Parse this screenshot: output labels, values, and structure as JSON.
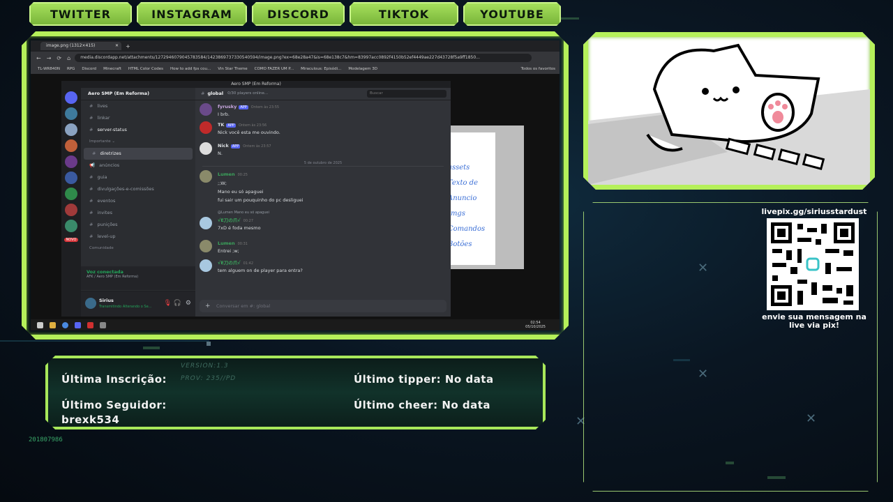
{
  "social_links": [
    "TWITTER",
    "INSTAGRAM",
    "DISCORD",
    "TIKTOK",
    "YOUTUBE"
  ],
  "browser": {
    "tab_title": "image.png (1312×415)",
    "url": "media.discordapp.net/attachments/1272946079045783584/1423869737330540594/image.png?ex=68e28a47&is=68e138c7&hm=83997acc0892f4150b52ef4449ae227d43728f5a9ff1850...",
    "bookmarks": [
      "TL-WR840N",
      "RPG",
      "Discord",
      "Minecraft",
      "HTML Color Codes",
      "How to add fps cou...",
      "Vin Star Theme",
      "COMO FAZER UM P...",
      "Miraculous: Episódi...",
      "Modelagem 3D",
      "Todos os favoritos"
    ]
  },
  "discord": {
    "window_title": "Aero SMP (Em Reforma)",
    "server_name": "Aero SMP (Em Reforma)",
    "channel_header": "global",
    "channel_topic": "0/30 players online...",
    "search_placeholder": "Buscar",
    "channels": [
      {
        "name": "lives"
      },
      {
        "name": "linkar"
      },
      {
        "name": "server-status",
        "active": true
      },
      {
        "name": "Importante",
        "category": true
      },
      {
        "name": "diretrizes",
        "active": true
      },
      {
        "name": "anúncios"
      },
      {
        "name": "guia"
      },
      {
        "name": "divulgações-e-comissões"
      },
      {
        "name": "eventos"
      },
      {
        "name": "invites"
      },
      {
        "name": "punições"
      },
      {
        "name": "level-up"
      },
      {
        "name": "Comunidade",
        "category": true
      }
    ],
    "new_badge": "NOVO",
    "voice_status": "Voz conectada",
    "voice_channel": "AFK / Aero SMP (Em Reforma)",
    "user_name": "Sirius",
    "user_status": "Transmitindo Alterando o Se...",
    "messages": [
      {
        "user": "fyrusky",
        "time": "Ontem às 23:55",
        "text": "I brb.",
        "app": true,
        "color": "#c9a8e0"
      },
      {
        "user": "TK",
        "time": "Ontem às 23:56",
        "text": "Nick você esta me ouvindo.",
        "app": true,
        "color": "#ffffff"
      },
      {
        "user": "Nick",
        "time": "Ontem às 23:57",
        "text": "N.",
        "app": true,
        "color": "#ffffff"
      },
      {
        "user": "Lumen",
        "time": "00:25",
        "text": ";;W;",
        "color": "#3ba55c"
      },
      {
        "user": "",
        "time": "",
        "text": "Mano eu só apaguei",
        "color": "#3ba55c"
      },
      {
        "user": "",
        "time": "",
        "text": "fui sair um pouquinho do pc desliguei",
        "color": "#3ba55c"
      },
      {
        "user": "√E刀の爪√",
        "time": "00:27",
        "text": "7xD é foda mesmo",
        "reply": "@Lumen Mano eu só apaguei",
        "color": "#3ba55c"
      },
      {
        "user": "Lumen",
        "time": "00:31",
        "text": "Entrei ;w;",
        "color": "#3ba55c"
      },
      {
        "user": "√E刀の爪√",
        "time": "01:42",
        "text": "tem alguem on de player para entra?",
        "color": "#3ba55c"
      }
    ],
    "date_divider": "5 de outubro de 2025",
    "input_placeholder": "Conversar em #: global"
  },
  "taskbar": {
    "time": "02:54",
    "date": "05/10/2025"
  },
  "image_notes": [
    "assets",
    "Texto de",
    "Anuncio",
    "Imgs",
    "Comandos",
    "Botões"
  ],
  "pix": {
    "url": "livepix.gg/siriusstardust",
    "caption": "envie sua mensagem na live via pix!"
  },
  "info": {
    "ultima_inscricao_label": "Última Inscrição:",
    "ultimo_seguidor_label": "Último Seguidor:",
    "ultimo_seguidor_value": "brexk534",
    "ultimo_tipper": "Último tipper: No data",
    "ultimo_cheer": "Último cheer: No data",
    "ghost_version": "VERSION:1.3",
    "ghost_prov": "PROV: 235//PD"
  },
  "bg_number": "201807986",
  "colors": {
    "frame": "#b5f05a",
    "accent_green": "#3ba55c",
    "discord_bg": "#313338"
  }
}
